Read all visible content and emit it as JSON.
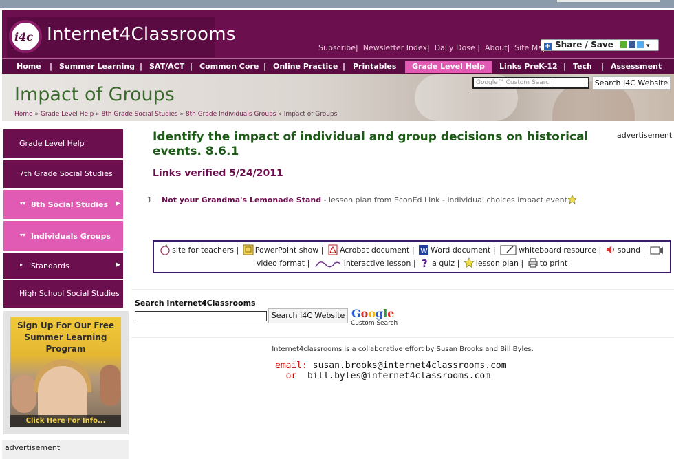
{
  "header": {
    "logo_mark": "i4c",
    "site_name": "Internet4Classrooms",
    "top_links": [
      "Subscribe",
      "Newsletter Index",
      "Daily Dose",
      "About",
      "Site Map"
    ],
    "share_label": "Share / Save"
  },
  "nav": {
    "items": [
      "Home",
      "Summer Learning",
      "SAT/ACT",
      "Common Core",
      "Online Practice",
      "Printables",
      "Grade Level Help",
      "Links PreK-12",
      "Tech",
      "Assessment"
    ],
    "active": "Grade Level Help",
    "separator": "|"
  },
  "banner": {
    "title": "Impact of Groups",
    "breadcrumb": [
      "Home",
      "Grade Level Help",
      "8th Grade Social Studies",
      "8th Grade Individuals Groups",
      "Impact of Groups"
    ],
    "breadcrumb_sep": "»",
    "search_placeholder": "Google™ Custom Search",
    "search_button": "Search I4C Website"
  },
  "sidebar": {
    "items": [
      "Grade Level Help",
      "7th Grade Social Studies",
      "8th Social Studies",
      "Individuals Groups",
      "Standards",
      "High School Social Studies"
    ],
    "promo": {
      "text": "Sign Up For Our Free Summer Learning Program",
      "cta": "Click Here For Info..."
    },
    "advertisement": "advertisement"
  },
  "main": {
    "title": "Identify the impact of individual and group decisions on historical events. 8.6.1",
    "advertisement": "advertisement",
    "verified": "Links verified 5/24/2011",
    "links": [
      {
        "num": "1.",
        "title": "Not your Grandma's Lemonade Stand",
        "desc": " - lesson plan from EconEd Link - individual choices impact event"
      }
    ],
    "legend": [
      {
        "icon": "apple-icon",
        "label": "site for teachers"
      },
      {
        "icon": "powerpoint-icon",
        "label": "PowerPoint show"
      },
      {
        "icon": "acrobat-icon",
        "label": "Acrobat document"
      },
      {
        "icon": "word-icon",
        "label": "Word document"
      },
      {
        "icon": "whiteboard-icon",
        "label": "whiteboard resource"
      },
      {
        "icon": "sound-icon",
        "label": "sound"
      },
      {
        "icon": "video-icon",
        "label": "video format"
      },
      {
        "icon": "interactive-icon",
        "label": "interactive lesson"
      },
      {
        "icon": "quiz-icon",
        "label": "a quiz"
      },
      {
        "icon": "lesson-plan-icon",
        "label": "lesson plan"
      },
      {
        "icon": "print-icon",
        "label": "to print"
      }
    ]
  },
  "search": {
    "label": "Search Internet4Classrooms",
    "button": "Search I4C Website",
    "google_word": "Google",
    "google_sub": "Custom Search"
  },
  "footer": {
    "note": "Internet4classrooms is a collaborative effort by Susan Brooks and Bill Byles.",
    "email_label": "email:",
    "email1": "susan.brooks@internet4classrooms.com",
    "or_label": "or",
    "email2": "bill.byles@internet4classrooms.com"
  },
  "colors": {
    "brand": "#6b0f4e",
    "accent_pink": "#e15bb4",
    "title_green": "#1f5b18"
  }
}
